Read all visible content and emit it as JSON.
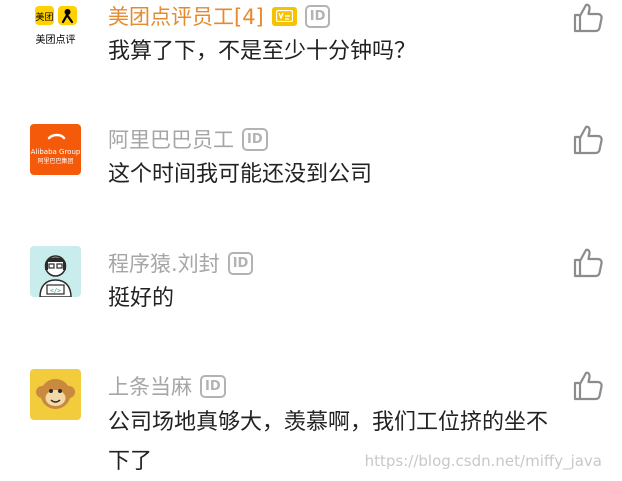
{
  "comments": [
    {
      "name": "美团点评员工[4]",
      "name_highlight": true,
      "has_vip_badge": true,
      "id_badge": "ID",
      "text": "我算了下，不是至少十分钟吗？",
      "avatar": {
        "icon": "meituan-logo",
        "label_top": "美团",
        "label_bottom": "美团点评",
        "bg": "#ffffff",
        "accent": "#ffd100"
      }
    },
    {
      "name": "阿里巴巴员工",
      "id_badge": "ID",
      "text": "这个时间我可能还没到公司",
      "avatar": {
        "icon": "alibaba-logo",
        "label_top": "Alibaba Group",
        "label_bottom": "阿里巴巴集团",
        "bg": "#f45a0a"
      }
    },
    {
      "name": "程序猿.刘封",
      "id_badge": "ID",
      "text": "挺好的",
      "avatar": {
        "icon": "programmer-avatar",
        "bg": "#c9ecec"
      }
    },
    {
      "name": "上条当麻",
      "id_badge": "ID",
      "text": "公司场地真够大，羡慕啊，我们工位挤的坐不下了",
      "avatar": {
        "icon": "monkey-avatar",
        "bg": "#f2cc3c"
      }
    }
  ],
  "watermark": "https://blog.csdn.net/miffy_java",
  "colors": {
    "name_gray": "#a6a6a6",
    "name_orange": "#e58a2e",
    "text": "#222222",
    "icon_gray": "#8c8c8c"
  }
}
